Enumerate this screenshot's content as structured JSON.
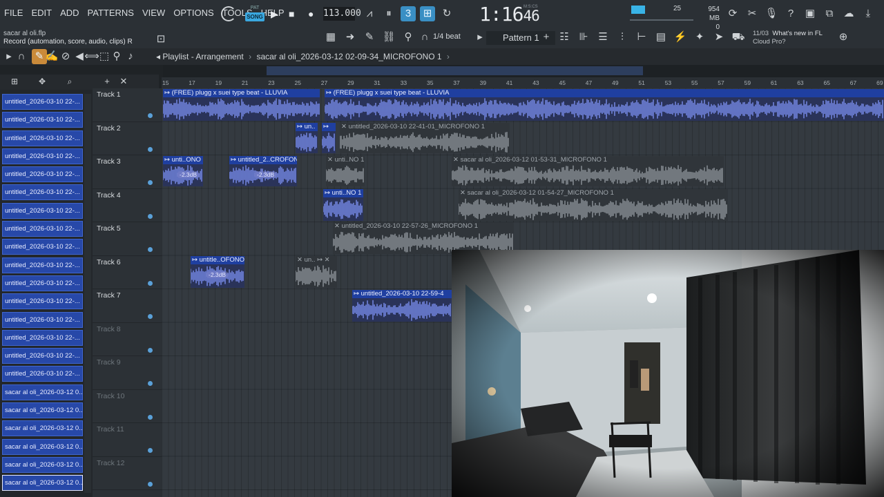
{
  "menu": [
    "FILE",
    "EDIT",
    "ADD",
    "PATTERNS",
    "VIEW",
    "OPTIONS",
    "TOOLS",
    "HELP"
  ],
  "mode": {
    "pat": "PAT",
    "song": "SONG"
  },
  "tempo": "113.000",
  "time": {
    "main": "1:16",
    "sub": "46",
    "unit": "M:S:CS"
  },
  "cpu": "25",
  "memory": {
    "mb": "954 MB",
    "value": "0"
  },
  "project": {
    "file": "sacar al oli.flp",
    "hint": "Record  (automation, score, audio, clips)  R"
  },
  "snap": "1/4 beat",
  "pattern": "Pattern 1",
  "news": {
    "date": "11/03",
    "title": "What's new in FL",
    "subtitle": "Cloud Pro?"
  },
  "breadcrumb": {
    "view": "Playlist - Arrangement",
    "sep": "›",
    "item": "sacar al oli_2026-03-12 02-09-34_MICROFONO 1"
  },
  "browser_clips": [
    "untitled_2026-03-10 22-...",
    "untitled_2026-03-10 22-...",
    "untitled_2026-03-10 22-...",
    "untitled_2026-03-10 22-...",
    "untitled_2026-03-10 22-...",
    "untitled_2026-03-10 22-...",
    "untitled_2026-03-10 22-...",
    "untitled_2026-03-10 22-...",
    "untitled_2026-03-10 22-...",
    "untitled_2026-03-10 22-...",
    "untitled_2026-03-10 22-...",
    "untitled_2026-03-10 22-...",
    "untitled_2026-03-10 22-...",
    "untitled_2026-03-10 22-...",
    "untitled_2026-03-10 22-...",
    "untitled_2026-03-10 22-...",
    "sacar al oli_2026-03-12 0...",
    "sacar al oli_2026-03-12 0...",
    "sacar al oli_2026-03-12 0...",
    "sacar al oli_2026-03-12 0...",
    "sacar al oli_2026-03-12 0...",
    "sacar al oli_2026-03-12 0..."
  ],
  "tracks": [
    "Track 1",
    "Track 2",
    "Track 3",
    "Track 4",
    "Track 5",
    "Track 6",
    "Track 7",
    "Track 8",
    "Track 9",
    "Track 10",
    "Track 11",
    "Track 12"
  ],
  "ruler": [
    "15",
    "17",
    "19",
    "21",
    "23",
    "25",
    "27",
    "29",
    "31",
    "33",
    "35",
    "37",
    "39",
    "41",
    "43",
    "45",
    "47",
    "49",
    "51",
    "53",
    "55",
    "57",
    "59",
    "61",
    "63",
    "65",
    "67",
    "69"
  ],
  "clips": {
    "t1a": "↦ (FREE) plugg x suei type beat - LLUVIA",
    "t1b": "↦ (FREE) plugg x suei type beat - LLUVIA",
    "t2a": "↦ un..",
    "t2b": "↦",
    "t2c": "✕ untitled_2026-03-10 22-41-01_MICROFONO 1",
    "t3a": "↦ unti..ONO 1",
    "t3b": "↦ untitled_2..CROFONO 1",
    "t3c": "✕ unti..NO 1",
    "t3d": "✕ sacar al oli_2026-03-12 01-53-31_MICROFONO 1",
    "t4a": "↦ unti..NO 1",
    "t4b": "✕ sacar al oli_2026-03-12 01-54-27_MICROFONO 1",
    "t5a": "✕ untitled_2026-03-10 22-57-26_MICROFONO 1",
    "t6a": "↦ untitle..OFONO 1",
    "t6b": "✕ un.. ↦ ✕",
    "t7a": "↦ untitled_2026-03-10 22-59-4",
    "gain": "-2.3dB"
  },
  "colors": {
    "clip_blue": "#2748a8",
    "wave_blue": "#7b8ff0",
    "wave_gray": "#8e959b",
    "accent": "#3aa8e0"
  }
}
